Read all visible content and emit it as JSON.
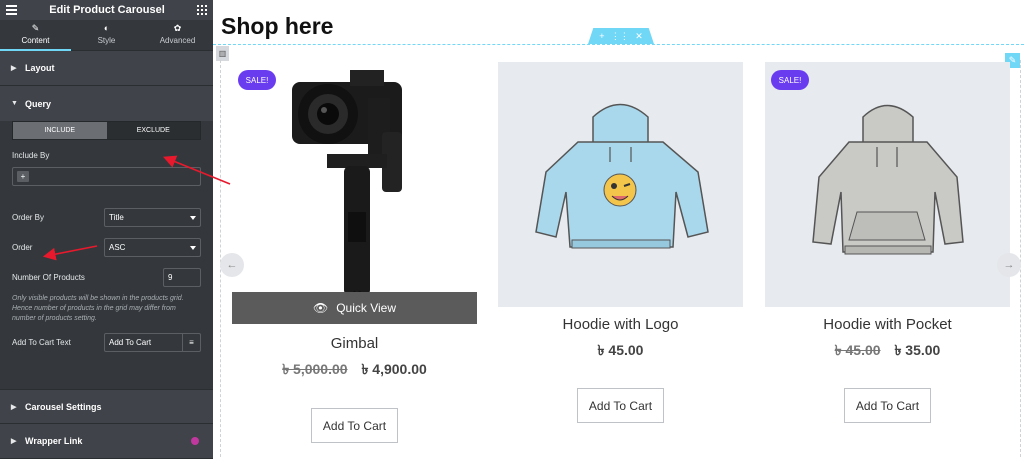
{
  "editor": {
    "title": "Edit Product Carousel",
    "tabs": [
      {
        "label": "Content",
        "icon": "pencil-icon"
      },
      {
        "label": "Style",
        "icon": "contrast-icon"
      },
      {
        "label": "Advanced",
        "icon": "gear-icon"
      }
    ],
    "sections": {
      "layout": "Layout",
      "query": "Query",
      "carousel_settings": "Carousel Settings",
      "wrapper_link": "Wrapper Link"
    },
    "query": {
      "include_label": "INCLUDE",
      "exclude_label": "EXCLUDE",
      "include_by_label": "Include By",
      "order_by_label": "Order By",
      "order_by_value": "Title",
      "order_label": "Order",
      "order_value": "ASC",
      "num_products_label": "Number Of Products",
      "num_products_value": "9",
      "note": "Only visible products will be shown in the products grid. Hence number of products in the grid may differ from number of products setting.",
      "cart_text_label": "Add To Cart Text",
      "cart_text_value": "Add To Cart"
    }
  },
  "page": {
    "heading": "Shop here",
    "products": [
      {
        "name": "Gimbal",
        "old_price": "৳ 5,000.00",
        "price": "৳ 4,900.00",
        "sale": "SALE!",
        "quick_view": "Quick View",
        "button": "Add To Cart"
      },
      {
        "name": "Hoodie with Logo",
        "price": "৳ 45.00",
        "button": "Add To Cart"
      },
      {
        "name": "Hoodie with Pocket",
        "old_price": "৳ 45.00",
        "price": "৳ 35.00",
        "sale": "SALE!",
        "button": "Add To Cart"
      }
    ]
  },
  "colors": {
    "panel_bg": "#34383c",
    "accent": "#71d7f7",
    "sale_badge": "#6a3cf0",
    "annotation_arrow": "#e8192c"
  }
}
